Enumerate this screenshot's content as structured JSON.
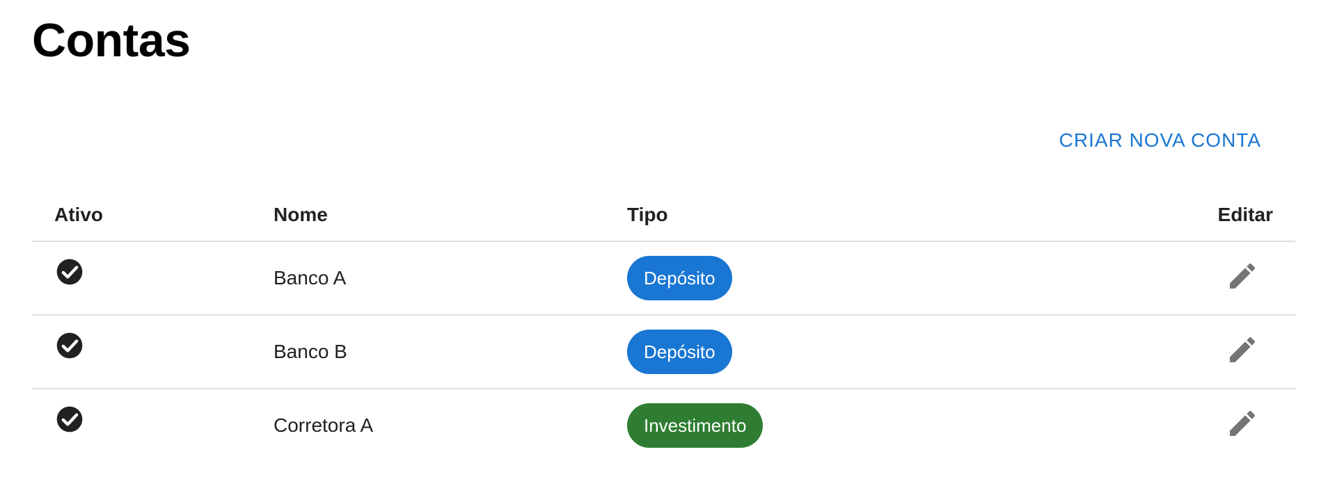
{
  "page": {
    "title": "Contas"
  },
  "toolbar": {
    "create_label": "CRIAR NOVA CONTA"
  },
  "table": {
    "headers": {
      "active": "Ativo",
      "name": "Nome",
      "type": "Tipo",
      "edit": "Editar"
    },
    "rows": [
      {
        "active": true,
        "name": "Banco A",
        "type": "Depósito",
        "type_color": "#1976d2"
      },
      {
        "active": true,
        "name": "Banco B",
        "type": "Depósito",
        "type_color": "#1976d2"
      },
      {
        "active": true,
        "name": "Corretora A",
        "type": "Investimento",
        "type_color": "#2e7d32"
      }
    ]
  },
  "icons": {
    "active": "check-circle-icon",
    "edit": "pencil-icon"
  },
  "colors": {
    "accent": "#1976d2",
    "deposit_chip": "#1976d2",
    "investment_chip": "#2e7d32",
    "edit_icon": "#757575",
    "check_icon": "#212121"
  }
}
